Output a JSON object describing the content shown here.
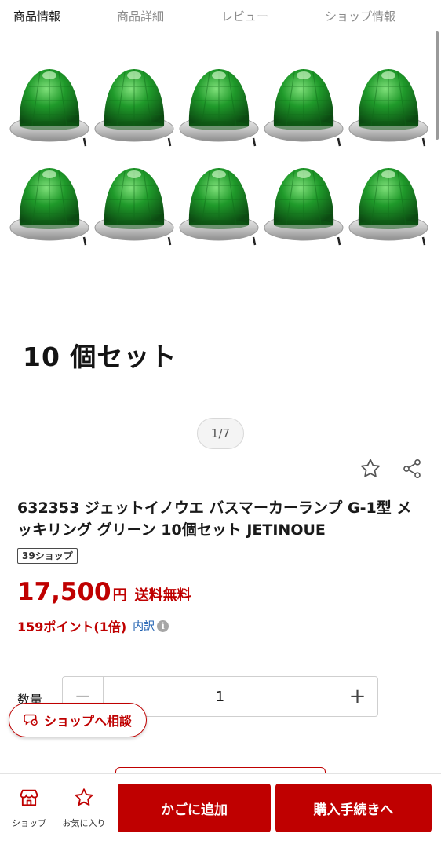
{
  "tabs": [
    {
      "label": "商品情報",
      "active": true
    },
    {
      "label": "商品詳細",
      "active": false
    },
    {
      "label": "レビュー",
      "active": false
    },
    {
      "label": "ショップ情報",
      "active": false
    }
  ],
  "gallery": {
    "image_caption": "10 個セット",
    "pager": "1/7",
    "lamp_color": "#1f9a2a",
    "ring_color": "#c8c8c8"
  },
  "product": {
    "title": "632353 ジェットイノウエ バスマーカーランプ G-1型 メッキリング グリーン 10個セット JETINOUE",
    "badge": "39ショップ",
    "price": "17,500",
    "yen": "円",
    "shipping": "送料無料",
    "points": "159ポイント(1倍)",
    "points_breakdown": "内訳",
    "info_icon": "i"
  },
  "quantity": {
    "label": "数量",
    "value": "1",
    "minus": "−",
    "plus": "+"
  },
  "consult": {
    "label": "ショップへ相談"
  },
  "bottom_bar": {
    "shop_label": "ショップ",
    "favorite_label": "お気に入り",
    "add_to_cart": "かごに追加",
    "checkout": "購入手続きへ"
  },
  "colors": {
    "accent": "#bf0000",
    "link": "#1d5fb0"
  },
  "icons": [
    "star-outline-icon",
    "share-icon",
    "info-icon",
    "chat-icon",
    "shop-icon",
    "star-icon"
  ]
}
